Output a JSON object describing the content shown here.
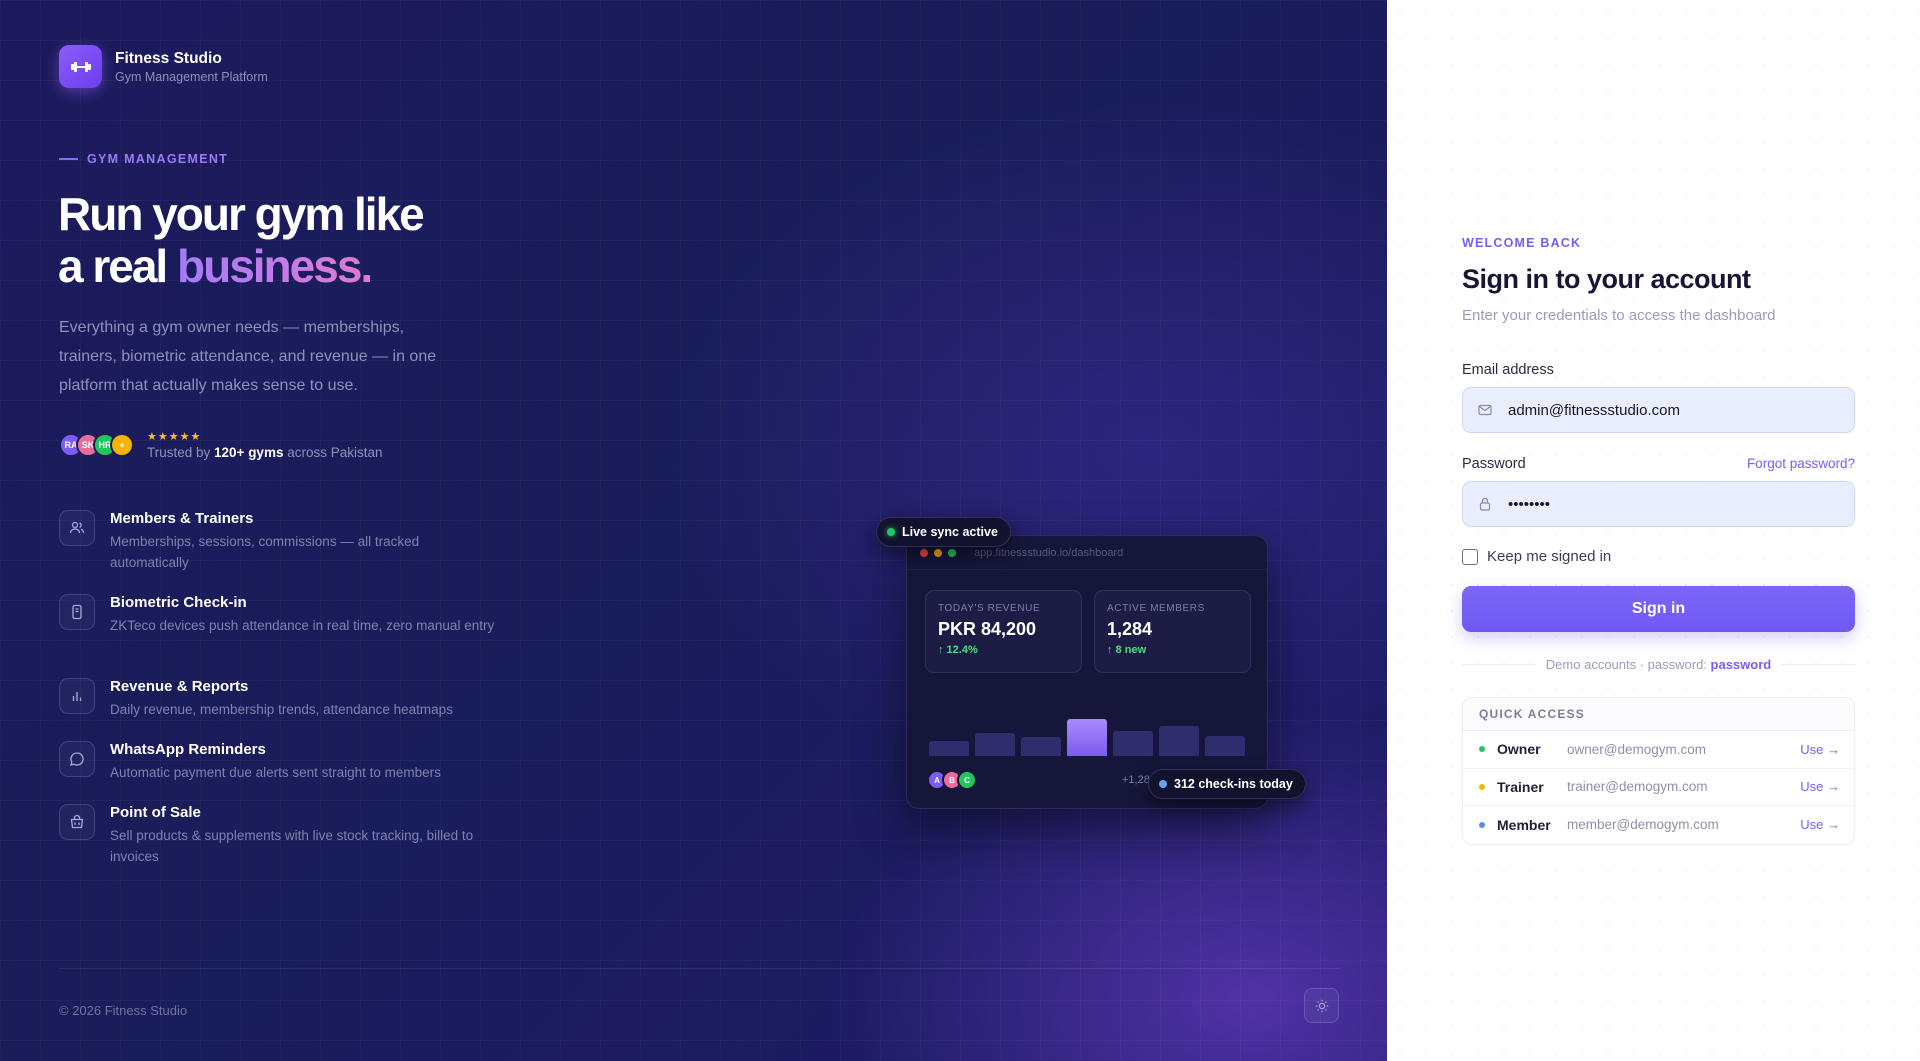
{
  "brand": {
    "name": "Fitness Studio",
    "subtitle": "Gym Management Platform",
    "logo_icon": "dumbbell-icon"
  },
  "hero": {
    "eyebrow": "GYM MANAGEMENT",
    "headline_line1": "Run your gym like",
    "headline_line2_plain": "a real ",
    "headline_line2_accent": "business.",
    "lead": "Everything a gym owner needs — memberships, trainers, biometric attendance, and revenue — in one platform that actually makes sense to use."
  },
  "trust": {
    "avatars": [
      {
        "initials": "RA",
        "color": "#7c5cf2"
      },
      {
        "initials": "SK",
        "color": "#ec6a9c"
      },
      {
        "initials": "HR",
        "color": "#22c55e"
      },
      {
        "initials": "+",
        "color": "#f5b400"
      }
    ],
    "stars": "★★★★★",
    "prefix": "Trusted by ",
    "highlight": "120+ gyms",
    "suffix": " across Pakistan"
  },
  "features": [
    {
      "icon": "users-icon",
      "title": "Members & Trainers",
      "desc": "Memberships, sessions, commissions — all tracked automatically"
    },
    {
      "icon": "device-icon",
      "title": "Biometric Check-in",
      "desc": "ZKTeco devices push attendance in real time, zero manual entry"
    },
    {
      "icon": "bar-chart-icon",
      "title": "Revenue & Reports",
      "desc": "Daily revenue, membership trends, attendance heatmaps"
    },
    {
      "icon": "chat-icon",
      "title": "WhatsApp Reminders",
      "desc": "Automatic payment due alerts sent straight to members"
    },
    {
      "icon": "basket-icon",
      "title": "Point of Sale",
      "desc": "Sell products & supplements with live stock tracking, billed to invoices"
    }
  ],
  "mock": {
    "url": "app.fitnessstudio.io/dashboard",
    "live_pill": "Live sync active",
    "checkins_pill": "312 check-ins today",
    "revenue": {
      "label": "TODAY'S REVENUE",
      "value": "PKR 84,200",
      "delta": "↑ 12.4%"
    },
    "members": {
      "label": "ACTIVE MEMBERS",
      "value": "1,284",
      "delta": "↑ 8 new"
    },
    "bars": [
      0.25,
      0.38,
      0.31,
      0.62,
      0.42,
      0.5,
      0.34
    ],
    "highlight_bar": 3,
    "avatars": [
      {
        "initials": "A",
        "color": "#7c5cf2"
      },
      {
        "initials": "B",
        "color": "#ec6a9c"
      },
      {
        "initials": "C",
        "color": "#22c55e"
      }
    ],
    "count_text": "+1,28"
  },
  "footer": {
    "copyright": "© 2026 Fitness Studio",
    "theme_icon": "sun-icon"
  },
  "signin": {
    "eyebrow": "WELCOME BACK",
    "title": "Sign in to your account",
    "subtitle": "Enter your credentials to access the dashboard",
    "email_label": "Email address",
    "email_value": "admin@fitnessstudio.com",
    "password_label": "Password",
    "password_value": "password",
    "forgot": "Forgot password?",
    "remember": "Keep me signed in",
    "submit": "Sign in",
    "demo_prefix": "Demo accounts · password: ",
    "demo_password": "password",
    "quick_access_title": "QUICK ACCESS",
    "accounts": [
      {
        "role": "Owner",
        "email": "owner@demogym.com",
        "use": "Use →",
        "color": "#22c55e"
      },
      {
        "role": "Trainer",
        "email": "trainer@demogym.com",
        "use": "Use →",
        "color": "#f5b400"
      },
      {
        "role": "Member",
        "email": "member@demogym.com",
        "use": "Use →",
        "color": "#5b8def"
      }
    ]
  },
  "colors": {
    "accent": "#7c5cf2",
    "panel_dark": "#1c1a5c",
    "success": "#4ade80"
  }
}
